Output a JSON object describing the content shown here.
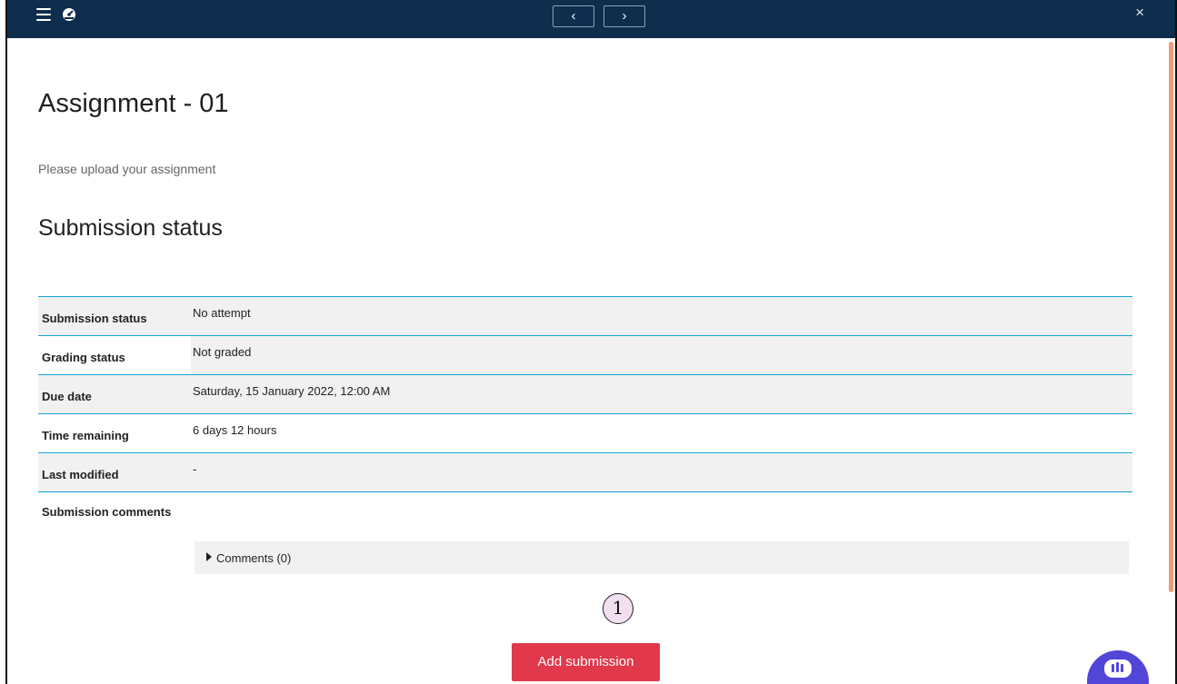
{
  "topbar": {
    "prev_label": "‹",
    "next_label": "›",
    "close_label": "×"
  },
  "page": {
    "title": "Assignment - 01",
    "intro": "Please upload your assignment",
    "section_title": "Submission status"
  },
  "status_rows": [
    {
      "label": "Submission status",
      "value": "No attempt"
    },
    {
      "label": "Grading status",
      "value": "Not graded"
    },
    {
      "label": "Due date",
      "value": "Saturday, 15 January 2022, 12:00 AM"
    },
    {
      "label": "Time remaining",
      "value": "6 days 12 hours"
    },
    {
      "label": "Last modified",
      "value": "-"
    },
    {
      "label": "Submission comments",
      "value": ""
    }
  ],
  "comments": {
    "label": "Comments (0)"
  },
  "marker": {
    "label": "1"
  },
  "actions": {
    "add_submission": "Add submission"
  },
  "colors": {
    "topbar": "#0f2d4c",
    "row_border": "#17a2d8",
    "primary_button": "#e1384b",
    "scrollbar": "#ef9b74",
    "chat": "#5146d8"
  }
}
